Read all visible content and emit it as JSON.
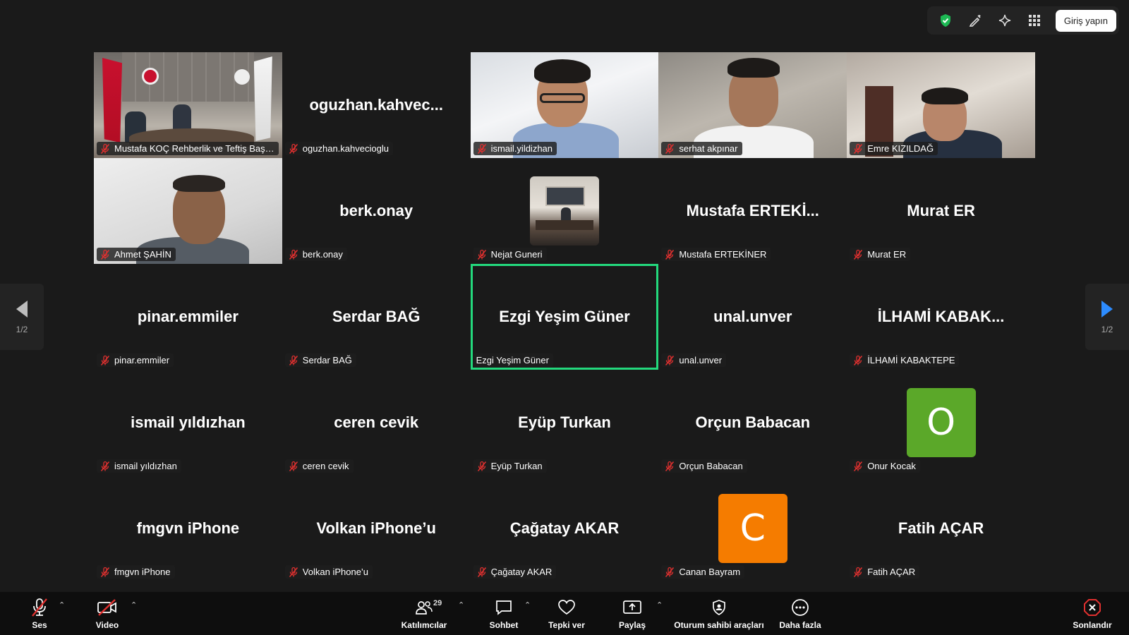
{
  "toolbar": {
    "icons": [
      "shield-check-icon",
      "annotate-icon",
      "sparkle-icon",
      "apps-grid-icon"
    ],
    "signin_label": "Giriş yapın",
    "shield_color": "#1db954"
  },
  "gallery": {
    "tiles": [
      {
        "display": "video",
        "video": "office",
        "tag": "Mustafa KOÇ Rehberlik ve Teftiş Başkan Yar..."
      },
      {
        "display": "name",
        "big": "oguzhan.kahvec...",
        "tag": "oguzhan.kahvecioglu"
      },
      {
        "display": "video",
        "video": "man1",
        "tag": "ismail.yildizhan"
      },
      {
        "display": "video",
        "video": "man2",
        "tag": "serhat akpınar"
      },
      {
        "display": "video",
        "video": "man3",
        "tag": "Emre KIZILDAĞ"
      },
      {
        "display": "video",
        "video": "man4",
        "tag": "Ahmet ŞAHİN"
      },
      {
        "display": "name",
        "big": "berk.onay",
        "tag": "berk.onay"
      },
      {
        "display": "photo",
        "tag": "Nejat Guneri"
      },
      {
        "display": "name",
        "big": "Mustafa  ERTEKİ...",
        "tag": "Mustafa ERTEKİNER"
      },
      {
        "display": "name",
        "big": "Murat ER",
        "tag": "Murat ER"
      },
      {
        "display": "name",
        "big": "pinar.emmiler",
        "tag": "pinar.emmiler"
      },
      {
        "display": "name",
        "big": "Serdar BAĞ",
        "tag": "Serdar BAĞ"
      },
      {
        "display": "name",
        "big": "Ezgi Yeşim Güner",
        "tag": "Ezgi Yeşim Güner",
        "active": true
      },
      {
        "display": "name",
        "big": "unal.unver",
        "tag": "unal.unver"
      },
      {
        "display": "name",
        "big": "İLHAMİ  KABAK...",
        "tag": "İLHAMİ KABAKTEPE"
      },
      {
        "display": "name",
        "big": "ismail yıldızhan",
        "tag": "ismail yıldızhan"
      },
      {
        "display": "name",
        "big": "ceren cevik",
        "tag": "ceren cevik"
      },
      {
        "display": "name",
        "big": "Eyüp Turkan",
        "tag": "Eyüp Turkan"
      },
      {
        "display": "name",
        "big": "Orçun Babacan",
        "tag": "Orçun Babacan"
      },
      {
        "display": "letter",
        "letter": "O",
        "color": "#5ba829",
        "tag": "Onur Kocak"
      },
      {
        "display": "name",
        "big": "fmgvn iPhone",
        "tag": "fmgvn iPhone"
      },
      {
        "display": "name",
        "big": "Volkan iPhone’u",
        "tag": "Volkan iPhone’u"
      },
      {
        "display": "name",
        "big": "Çağatay AKAR",
        "tag": "Çağatay AKAR"
      },
      {
        "display": "letter",
        "letter": "C",
        "color": "#f57c00",
        "tag": "Canan Bayram"
      },
      {
        "display": "name",
        "big": "Fatih AÇAR",
        "tag": "Fatih AÇAR"
      }
    ],
    "active_border_color": "#23d97d",
    "mic_off_color": "#e0302f"
  },
  "pager": {
    "left_page": "1/2",
    "right_page": "1/2",
    "right_arrow_color": "#2d8cff"
  },
  "controls": {
    "audio_label": "Ses",
    "video_label": "Video",
    "participants_label": "Katılımcılar",
    "participants_count": "29",
    "chat_label": "Sohbet",
    "react_label": "Tepki ver",
    "share_label": "Paylaş",
    "host_tools_label": "Oturum sahibi araçları",
    "more_label": "Daha fazla",
    "end_label": "Sonlandır",
    "end_color": "#e0302f"
  }
}
